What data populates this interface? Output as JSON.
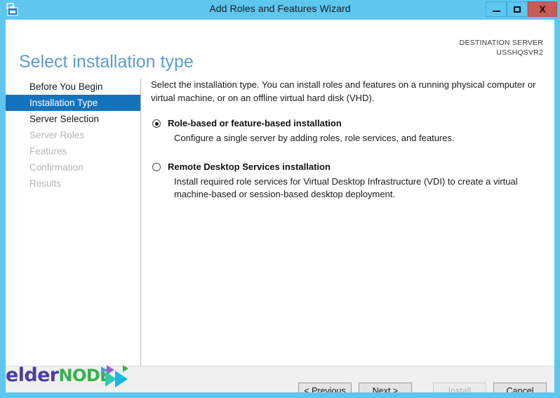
{
  "window": {
    "title": "Add Roles and Features Wizard",
    "icon": "server-manager-icon",
    "controls": {
      "minimize": "minimize-icon",
      "maximize": "maximize-icon",
      "close": "X"
    },
    "accent_color": "#5ec6ef",
    "close_color": "#c75b57"
  },
  "header": {
    "page_title": "Select installation type",
    "destination_label": "DESTINATION SERVER",
    "destination_value": "USSHQSVR2",
    "title_color": "#5b9bd5"
  },
  "sidebar": {
    "selected_color": "#1373bd",
    "items": [
      {
        "label": "Before You Begin",
        "state": "enabled"
      },
      {
        "label": "Installation Type",
        "state": "selected"
      },
      {
        "label": "Server Selection",
        "state": "enabled"
      },
      {
        "label": "Server Roles",
        "state": "disabled"
      },
      {
        "label": "Features",
        "state": "disabled"
      },
      {
        "label": "Confirmation",
        "state": "disabled"
      },
      {
        "label": "Results",
        "state": "disabled"
      }
    ]
  },
  "content": {
    "intro": "Select the installation type. You can install roles and features on a running physical computer or virtual machine, or on an offline virtual hard disk (VHD).",
    "options": [
      {
        "title": "Role-based or feature-based installation",
        "description": "Configure a single server by adding roles, role services, and features.",
        "selected": true
      },
      {
        "title": "Remote Desktop Services installation",
        "description": "Install required role services for Virtual Desktop Infrastructure (VDI) to create a virtual machine-based or session-based desktop deployment.",
        "selected": false
      }
    ]
  },
  "footer": {
    "buttons": [
      {
        "label": "< Previous",
        "enabled": true
      },
      {
        "label": "Next >",
        "enabled": true
      },
      {
        "label": "Install",
        "enabled": false
      },
      {
        "label": "Cancel",
        "enabled": true
      }
    ]
  },
  "watermark": {
    "text_primary": "elder",
    "text_secondary": "node",
    "color_primary": "#4b3f9e",
    "color_secondary": "#35b34a",
    "color_accent": "#19b6e8"
  }
}
